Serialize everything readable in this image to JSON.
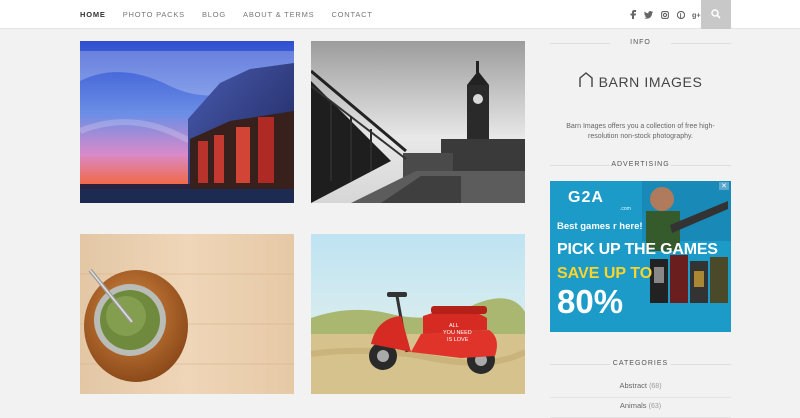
{
  "nav": {
    "items": [
      {
        "label": "HOME",
        "active": true
      },
      {
        "label": "PHOTO PACKS",
        "active": false
      },
      {
        "label": "BLOG",
        "active": false
      },
      {
        "label": "ABOUT & TERMS",
        "active": false
      },
      {
        "label": "CONTACT",
        "active": false
      }
    ],
    "social_icons": [
      "facebook-icon",
      "twitter-icon",
      "instagram-icon",
      "pinterest-icon",
      "google-plus-icon"
    ],
    "search_icon": "search-icon"
  },
  "photos": [
    {
      "name": "photo-concert-hall"
    },
    {
      "name": "photo-clock-tower"
    },
    {
      "name": "photo-mate-cup"
    },
    {
      "name": "photo-red-scooter"
    }
  ],
  "sidebar": {
    "info_title": "INFO",
    "logo_text": "BARN IMAGES",
    "about_text": "Barn Images offers you a collection of free high-resolution non-stock photography.",
    "advertising_title": "ADVERTISING",
    "ad": {
      "brand": "G2A",
      "brand_sub": ".com",
      "line1": "Best games r here!",
      "line2": "PICK UP THE GAMES",
      "line3": "SAVE UP TO",
      "line4": "80%"
    },
    "categories_title": "CATEGORIES",
    "categories": [
      {
        "name": "Abstract",
        "count": "(68)"
      },
      {
        "name": "Animals",
        "count": "(63)"
      }
    ]
  },
  "colors": {
    "accent": "#1c9bc8",
    "search_bg": "#c8c8c8",
    "background": "#f2f2f2"
  }
}
